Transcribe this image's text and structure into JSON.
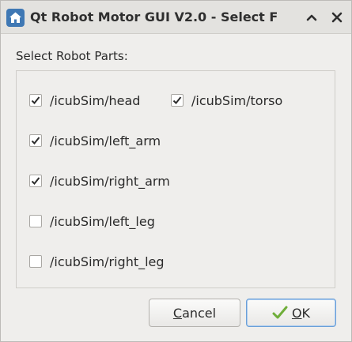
{
  "window": {
    "title": "Qt Robot Motor GUI V2.0 - Select F",
    "controls": {
      "up_icon": "chevron-up-icon",
      "close_icon": "close-icon"
    }
  },
  "main": {
    "section_label": "Select Robot Parts:",
    "parts": [
      {
        "label": "/icubSim/head",
        "checked": true
      },
      {
        "label": "/icubSim/torso",
        "checked": true
      },
      {
        "label": "/icubSim/left_arm",
        "checked": true
      },
      {
        "label": "/icubSim/right_arm",
        "checked": true
      },
      {
        "label": "/icubSim/left_leg",
        "checked": false
      },
      {
        "label": "/icubSim/right_leg",
        "checked": false
      }
    ]
  },
  "buttons": {
    "cancel_mnemonic": "C",
    "cancel_rest": "ancel",
    "ok_mnemonic": "O",
    "ok_rest": "K"
  },
  "colors": {
    "accent": "#3f78b4",
    "ok_icon": "#6fae3a",
    "background": "#efeeec"
  }
}
